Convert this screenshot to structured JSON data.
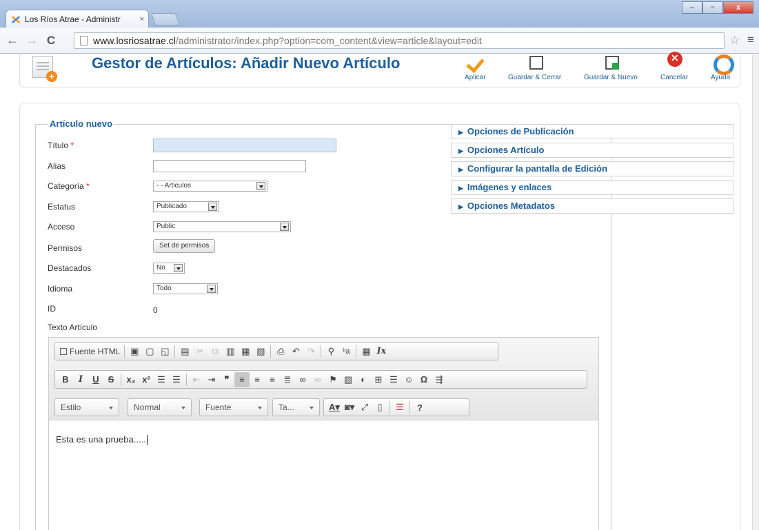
{
  "browser": {
    "tab_title": "Los Ríos Atrae - Administr",
    "tab_close": "×",
    "url_host": "www.losriosatrae.cl",
    "url_path": "/administrator/index.php?option=com_content&view=article&layout=edit",
    "back": "←",
    "forward": "→",
    "reload": "C",
    "star": "☆",
    "menu": "≡",
    "win_min": "–",
    "win_max": "▫",
    "win_close": "x"
  },
  "header": {
    "title": "Gestor de Artículos: Añadir Nuevo Artículo",
    "toolbar": [
      {
        "label": "Aplicar",
        "icon": "check-icon"
      },
      {
        "label": "Guardar & Cerrar",
        "icon": "save-close-icon"
      },
      {
        "label": "Guardar & Nuevo",
        "icon": "save-new-icon"
      },
      {
        "label": "Cancelar",
        "icon": "cancel-icon"
      },
      {
        "label": "Ayuda",
        "icon": "help-icon"
      }
    ]
  },
  "form": {
    "legend": "Artículo nuevo",
    "required_mark": "*",
    "fields": {
      "titulo": {
        "label": "Título",
        "value": ""
      },
      "alias": {
        "label": "Alias",
        "value": ""
      },
      "categoria": {
        "label": "Categoría",
        "selected": "- - Articulos"
      },
      "estatus": {
        "label": "Estatus",
        "selected": "Publicado"
      },
      "acceso": {
        "label": "Acceso",
        "selected": "Public"
      },
      "permisos": {
        "label": "Permisos",
        "button": "Set de permisos"
      },
      "destacados": {
        "label": "Destacados",
        "selected": "No"
      },
      "idioma": {
        "label": "Idioma",
        "selected": "Todo"
      },
      "id": {
        "label": "ID",
        "value": "0"
      },
      "texto": {
        "label": "Texto Artículo"
      }
    }
  },
  "accordion": [
    "Opciones de Publicación",
    "Opciones Artículo",
    "Configurar la pantalla de Edición",
    "Imágenes y enlaces",
    "Opciones Metadatos"
  ],
  "editor": {
    "source_button": "Fuente HTML",
    "combos": [
      "Estilo",
      "Normal",
      "Fuente",
      "Ta..."
    ],
    "content": "Esta es una prueba....."
  }
}
